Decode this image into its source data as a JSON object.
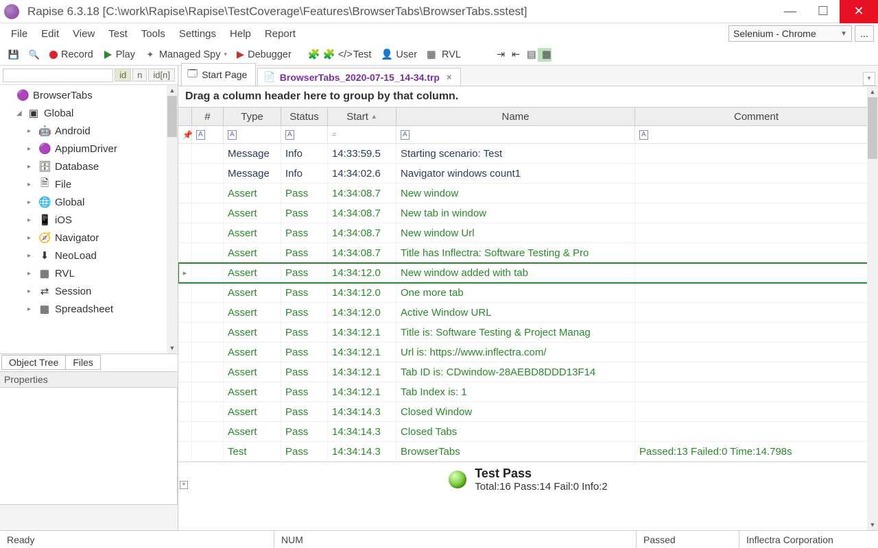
{
  "title": "Rapise 6.3.18 [C:\\work\\Rapise\\Rapise\\TestCoverage\\Features\\BrowserTabs\\BrowserTabs.sstest]",
  "menu": [
    "File",
    "Edit",
    "View",
    "Test",
    "Tools",
    "Settings",
    "Help",
    "Report"
  ],
  "browserCombo": "Selenium - Chrome",
  "dots": "...",
  "toolbar": {
    "record": "Record",
    "play": "Play",
    "spy": "Managed Spy",
    "debugger": "Debugger",
    "test": "Test",
    "user": "User",
    "rvl": "RVL"
  },
  "filterBtns": {
    "id": "id",
    "n": "n",
    "idn": "id[n]"
  },
  "treeRoot": "BrowserTabs",
  "treeGlobal": "Global",
  "treeItems": [
    "Android",
    "AppiumDriver",
    "Database",
    "File",
    "Global",
    "iOS",
    "Navigator",
    "NeoLoad",
    "RVL",
    "Session",
    "Spreadsheet"
  ],
  "treeIcons": [
    "🤖",
    "🟣",
    "🗄",
    "🗎",
    "🌐",
    "📱",
    "🧭",
    "⬇",
    "▦",
    "⇄",
    "▦"
  ],
  "bottomTabs": {
    "objectTree": "Object Tree",
    "files": "Files"
  },
  "propsHeader": "Properties",
  "docTabs": {
    "start": "Start Page",
    "report": "BrowserTabs_2020-07-15_14-34.trp"
  },
  "groupHint": "Drag a column header here to group by that column.",
  "columns": [
    "#",
    "Type",
    "Status",
    "Start",
    "Name",
    "Comment"
  ],
  "rows": [
    {
      "type": "Message",
      "status": "Info",
      "start": "14:33:59.5",
      "name": "Starting scenario: Test",
      "comment": "",
      "cls": "dark"
    },
    {
      "type": "Message",
      "status": "Info",
      "start": "14:34:02.6",
      "name": "Navigator windows count1",
      "comment": "",
      "cls": "dark"
    },
    {
      "type": "Assert",
      "status": "Pass",
      "start": "14:34:08.7",
      "name": "New window",
      "comment": "",
      "cls": "green"
    },
    {
      "type": "Assert",
      "status": "Pass",
      "start": "14:34:08.7",
      "name": "New tab in window",
      "comment": "",
      "cls": "green"
    },
    {
      "type": "Assert",
      "status": "Pass",
      "start": "14:34:08.7",
      "name": "New window Url",
      "comment": "",
      "cls": "green"
    },
    {
      "type": "Assert",
      "status": "Pass",
      "start": "14:34:08.7",
      "name": "Title has Inflectra: Software Testing & Pro",
      "comment": "",
      "cls": "green"
    },
    {
      "type": "Assert",
      "status": "Pass",
      "start": "14:34:12.0",
      "name": "New window added with tab",
      "comment": "",
      "cls": "green",
      "sel": true
    },
    {
      "type": "Assert",
      "status": "Pass",
      "start": "14:34:12.0",
      "name": "One more tab",
      "comment": "",
      "cls": "green"
    },
    {
      "type": "Assert",
      "status": "Pass",
      "start": "14:34:12.0",
      "name": "Active Window URL",
      "comment": "",
      "cls": "green"
    },
    {
      "type": "Assert",
      "status": "Pass",
      "start": "14:34:12.1",
      "name": "Title is: Software Testing & Project Manag",
      "comment": "",
      "cls": "green"
    },
    {
      "type": "Assert",
      "status": "Pass",
      "start": "14:34:12.1",
      "name": "Url is: https://www.inflectra.com/",
      "comment": "",
      "cls": "green"
    },
    {
      "type": "Assert",
      "status": "Pass",
      "start": "14:34:12.1",
      "name": "Tab ID is: CDwindow-28AEBD8DDD13F14",
      "comment": "",
      "cls": "green"
    },
    {
      "type": "Assert",
      "status": "Pass",
      "start": "14:34:12.1",
      "name": "Tab Index is: 1",
      "comment": "",
      "cls": "green"
    },
    {
      "type": "Assert",
      "status": "Pass",
      "start": "14:34:14.3",
      "name": "Closed Window",
      "comment": "",
      "cls": "green"
    },
    {
      "type": "Assert",
      "status": "Pass",
      "start": "14:34:14.3",
      "name": "Closed Tabs",
      "comment": "",
      "cls": "green"
    },
    {
      "type": "Test",
      "status": "Pass",
      "start": "14:34:14.3",
      "name": "BrowserTabs",
      "comment": "Passed:13 Failed:0 Time:14.798s",
      "cls": "green"
    }
  ],
  "summary": {
    "title": "Test Pass",
    "detail": "Total:16 Pass:14 Fail:0 Info:2"
  },
  "status": {
    "ready": "Ready",
    "num": "NUM",
    "passed": "Passed",
    "company": "Inflectra Corporation"
  }
}
